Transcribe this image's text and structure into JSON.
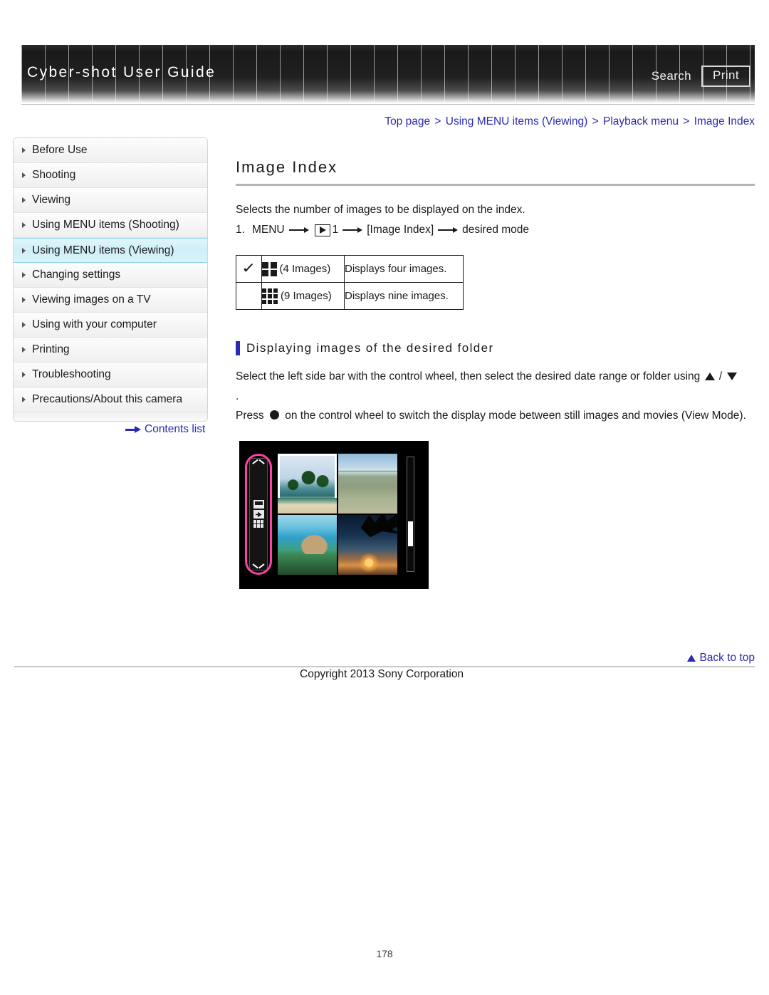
{
  "header": {
    "title": "Cyber-shot User Guide",
    "search_label": "Search",
    "print_label": "Print"
  },
  "breadcrumb": {
    "items": [
      "Top page",
      "Using MENU items (Viewing)",
      "Playback menu",
      "Image Index"
    ],
    "separator": ">"
  },
  "sidebar": {
    "items": [
      {
        "label": "Before Use",
        "active": false
      },
      {
        "label": "Shooting",
        "active": false
      },
      {
        "label": "Viewing",
        "active": false
      },
      {
        "label": "Using MENU items (Shooting)",
        "active": false
      },
      {
        "label": "Using MENU items (Viewing)",
        "active": true
      },
      {
        "label": "Changing settings",
        "active": false
      },
      {
        "label": "Viewing images on a TV",
        "active": false
      },
      {
        "label": "Using with your computer",
        "active": false
      },
      {
        "label": "Printing",
        "active": false
      },
      {
        "label": "Troubleshooting",
        "active": false
      },
      {
        "label": "Precautions/About this camera",
        "active": false
      }
    ],
    "contents_list_label": "Contents list"
  },
  "main": {
    "page_title": "Image Index",
    "intro": "Selects the number of images to be displayed on the index.",
    "step": {
      "number": "1.",
      "menu_label": "MENU",
      "tab_number": "1",
      "bracket_item": "[Image Index]",
      "result": "desired mode"
    },
    "options_table": {
      "rows": [
        {
          "checked": "✓",
          "mode_label": "(4 Images)",
          "icon": "grid-4-icon",
          "description": "Displays four images."
        },
        {
          "checked": "",
          "mode_label": "(9 Images)",
          "icon": "grid-9-icon",
          "description": "Displays nine images."
        }
      ]
    },
    "section": {
      "heading": "Displaying images of the desired folder",
      "paragraph_1_a": "Select the left side bar with the control wheel, then select the desired date range or folder using",
      "paragraph_1_sep": "/",
      "paragraph_1_b": ".",
      "paragraph_2_a": "Press",
      "paragraph_2_b": "on the control wheel to switch the display mode between still images and movies (View Mode)."
    }
  },
  "footer": {
    "back_to_top": "Back to top",
    "copyright": "Copyright 2013 Sony Corporation",
    "page_number": "178"
  },
  "colors": {
    "link": "#2a2ab0",
    "accent_bar": "#2a2ab0",
    "active_sidebar": "#cfeff8",
    "highlight_ring": "#ff3fa4"
  }
}
